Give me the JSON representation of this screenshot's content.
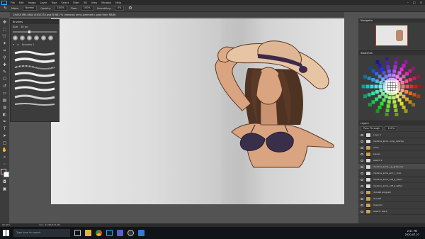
{
  "app": {
    "menu": [
      "File",
      "Edit",
      "Image",
      "Layer",
      "Type",
      "Select",
      "Filter",
      "3D",
      "View",
      "Window",
      "Help"
    ],
    "window_controls": [
      "–",
      "□",
      "✕"
    ]
  },
  "options_bar": {
    "mode_label": "Mode:",
    "mode_value": "Normal",
    "opacity_label": "Opacity:",
    "opacity_value": "100%",
    "flow_label": "Flow:",
    "flow_value": "100%",
    "smoothing_label": "Smoothing:",
    "smoothing_value": "0%"
  },
  "document": {
    "tab_title": "CHASE MELONIA (4632252.psd @ 66.7% (melonia arms jammed n grab from R8/8)"
  },
  "brush_panel": {
    "title": "Brushes",
    "size_label": "Size",
    "size_value": "30 px",
    "size_fraction": 0.35,
    "folder_label": "Brushes 1"
  },
  "right_panels": {
    "navigator_title": "Navigator",
    "color_title": "Swatches",
    "layers_title": "Layers",
    "layers_mode": "Pass Through",
    "layers_opacity": "100%",
    "layers": [
      {
        "name": "Layer 1",
        "kind": "layer"
      },
      {
        "name": "melonia_arms...crop_overlay",
        "kind": "layer"
      },
      {
        "name": "arms",
        "kind": "group"
      },
      {
        "name": "pieces",
        "kind": "group"
      },
      {
        "name": "sketch 2",
        "kind": "layer"
      },
      {
        "name": "melonia_arms_r_p_grab_hat",
        "kind": "layer"
      },
      {
        "name": "melonia_arms_arm_r_crop",
        "kind": "layer"
      },
      {
        "name": "melonia_arms_ruff_p_heart",
        "kind": "layer"
      },
      {
        "name": "melonia_arms_ruff_p_leftv2",
        "kind": "layer"
      },
      {
        "name": "doodad program",
        "kind": "group"
      },
      {
        "name": "doodad",
        "kind": "group"
      },
      {
        "name": "linecolor",
        "kind": "group"
      },
      {
        "name": "sketch: black",
        "kind": "group"
      }
    ],
    "selected_layer_index": 5
  },
  "status_bar": {
    "zoom": "66.67%",
    "doc_info": "Doc: 34.3M/727.4M"
  },
  "taskbar": {
    "search_placeholder": "Type here to search",
    "time": "2:51 PM",
    "date": "2020-07-27"
  },
  "colors": {
    "accent": "#31a8ff",
    "skin": "#d9a47f",
    "hair": "#5a3a27",
    "hat": "#e7c4a3",
    "hat_band": "#3b2a49",
    "bra": "#3a2f4b"
  }
}
